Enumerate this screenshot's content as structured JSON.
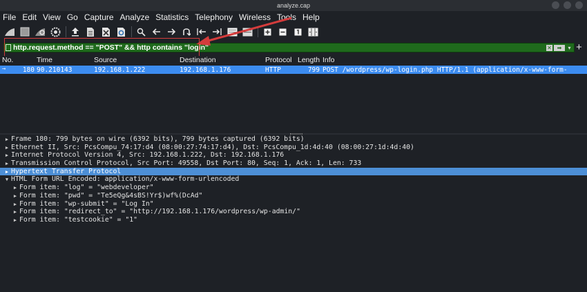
{
  "window": {
    "title": "analyze.cap"
  },
  "menu": [
    "File",
    "Edit",
    "View",
    "Go",
    "Capture",
    "Analyze",
    "Statistics",
    "Telephony",
    "Wireless",
    "Tools",
    "Help"
  ],
  "toolbar": {
    "icons": [
      "shark-fin-icon",
      "stop-icon",
      "restart-icon",
      "options-gear-icon",
      "open-file-icon",
      "save-file-icon",
      "close-file-icon",
      "reload-icon",
      "search-icon",
      "back-arrow-icon",
      "forward-arrow-icon",
      "go-to-packet-icon",
      "first-packet-icon",
      "last-packet-icon",
      "autoscroll-icon",
      "colorize-icon",
      "zoom-in-icon",
      "zoom-out-icon",
      "normal-size-icon",
      "resize-columns-icon"
    ]
  },
  "filter": {
    "value": "http.request.method == \"POST\" && http contains \"login\"",
    "background_color": "#1f6a1c"
  },
  "packet_list": {
    "headers": {
      "no": "No.",
      "time": "Time",
      "source": "Source",
      "destination": "Destination",
      "protocol": "Protocol",
      "length": "Length",
      "info": "Info"
    },
    "rows": [
      {
        "no": "180",
        "time": "90.210143",
        "source": "192.168.1.222",
        "destination": "192.168.1.176",
        "protocol": "HTTP",
        "length": "799",
        "info": "POST /wordpress/wp-login.php HTTP/1.1  (application/x-www-form-"
      }
    ],
    "selected_color": "#3c8cf0"
  },
  "details": {
    "lines": [
      "Frame 180: 799 bytes on wire (6392 bits), 799 bytes captured (6392 bits)",
      "Ethernet II, Src: PcsCompu_74:17:d4 (08:00:27:74:17:d4), Dst: PcsCompu_1d:4d:40 (08:00:27:1d:4d:40)",
      "Internet Protocol Version 4, Src: 192.168.1.222, Dst: 192.168.1.176",
      "Transmission Control Protocol, Src Port: 49558, Dst Port: 80, Seq: 1, Ack: 1, Len: 733",
      "Hypertext Transfer Protocol",
      "HTML Form URL Encoded: application/x-www-form-urlencoded",
      "Form item: \"log\" = \"webdeveloper\"",
      "Form item: \"pwd\" = \"Te5eQg&4sBS!Yr$)wf%(DcAd\"",
      "Form item: \"wp-submit\" = \"Log In\"",
      "Form item: \"redirect_to\" = \"http://192.168.1.176/wordpress/wp-admin/\"",
      "Form item: \"testcookie\" = \"1\""
    ],
    "highlight_color": "#4d8fd6"
  },
  "annotation": {
    "color": "#d43c3c"
  }
}
